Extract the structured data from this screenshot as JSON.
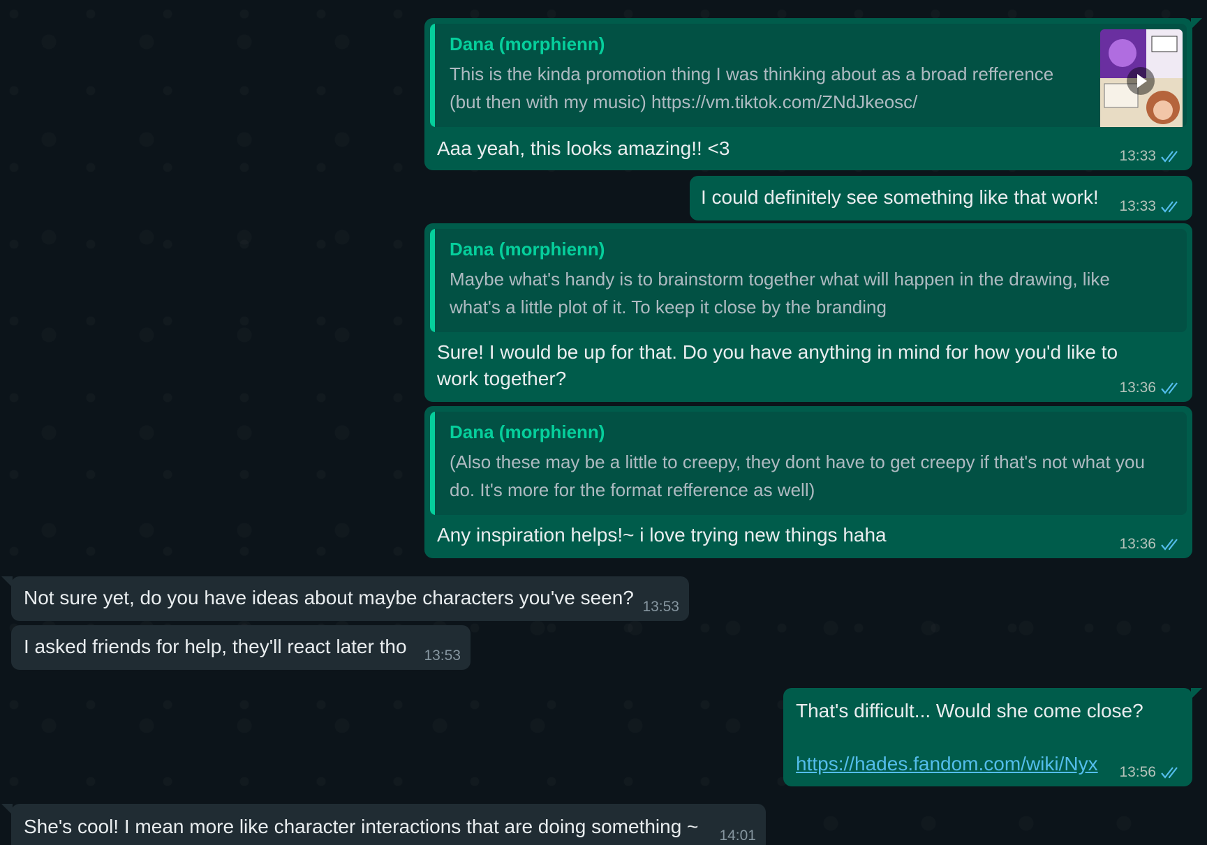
{
  "messages": [
    {
      "id": "m1",
      "direction": "outgoing",
      "quote": {
        "author": "Dana (morphienn)",
        "text_line1": "This is the kinda promotion thing I was thinking about as a broad refference",
        "text_line2": "(but then with my music) https://vm.tiktok.com/ZNdJkeosc/",
        "has_video_thumbnail": true
      },
      "text": "Aaa yeah, this looks amazing!! <3",
      "time": "13:33",
      "status": "read"
    },
    {
      "id": "m2",
      "direction": "outgoing",
      "text": "I could definitely see something like that work!",
      "time": "13:33",
      "status": "read"
    },
    {
      "id": "m3",
      "direction": "outgoing",
      "quote": {
        "author": "Dana (morphienn)",
        "text_line1": "Maybe what's handy is to brainstorm together what will happen in the drawing, like",
        "text_line2": "what's a little plot of it. To keep it close by the branding"
      },
      "text": "Sure! I would be up for that. Do you have anything in mind for how you'd like to work together?",
      "time": "13:36",
      "status": "read"
    },
    {
      "id": "m4",
      "direction": "outgoing",
      "quote": {
        "author": "Dana (morphienn)",
        "text_line1": "(Also these may be a little to creepy, they dont have to get creepy if that's not what you",
        "text_line2": "do. It's more for the format refference as well)"
      },
      "text": "Any inspiration helps!~ i love trying new things haha",
      "time": "13:36",
      "status": "read"
    },
    {
      "id": "m5",
      "direction": "incoming",
      "text": "Not sure yet, do you have ideas about maybe characters you've seen?",
      "time": "13:53"
    },
    {
      "id": "m6",
      "direction": "incoming",
      "text": "I asked friends for help, they'll react later tho",
      "time": "13:53"
    },
    {
      "id": "m7",
      "direction": "outgoing",
      "text": "That's difficult... Would she come close?",
      "link": "https://hades.fandom.com/wiki/Nyx",
      "time": "13:56",
      "status": "read"
    },
    {
      "id": "m8",
      "direction": "incoming",
      "text": "She's cool! I mean more like character interactions that are doing something ~",
      "time": "14:01"
    }
  ],
  "icons": {
    "read_receipt": "double-check-icon",
    "video_play": "play-icon"
  },
  "colors": {
    "background": "#0b141a",
    "outgoing_bubble": "#005c4b",
    "incoming_bubble": "#202c33",
    "quote_accent": "#06cf9c",
    "read_tick": "#53bdeb",
    "link": "#53bdeb"
  }
}
